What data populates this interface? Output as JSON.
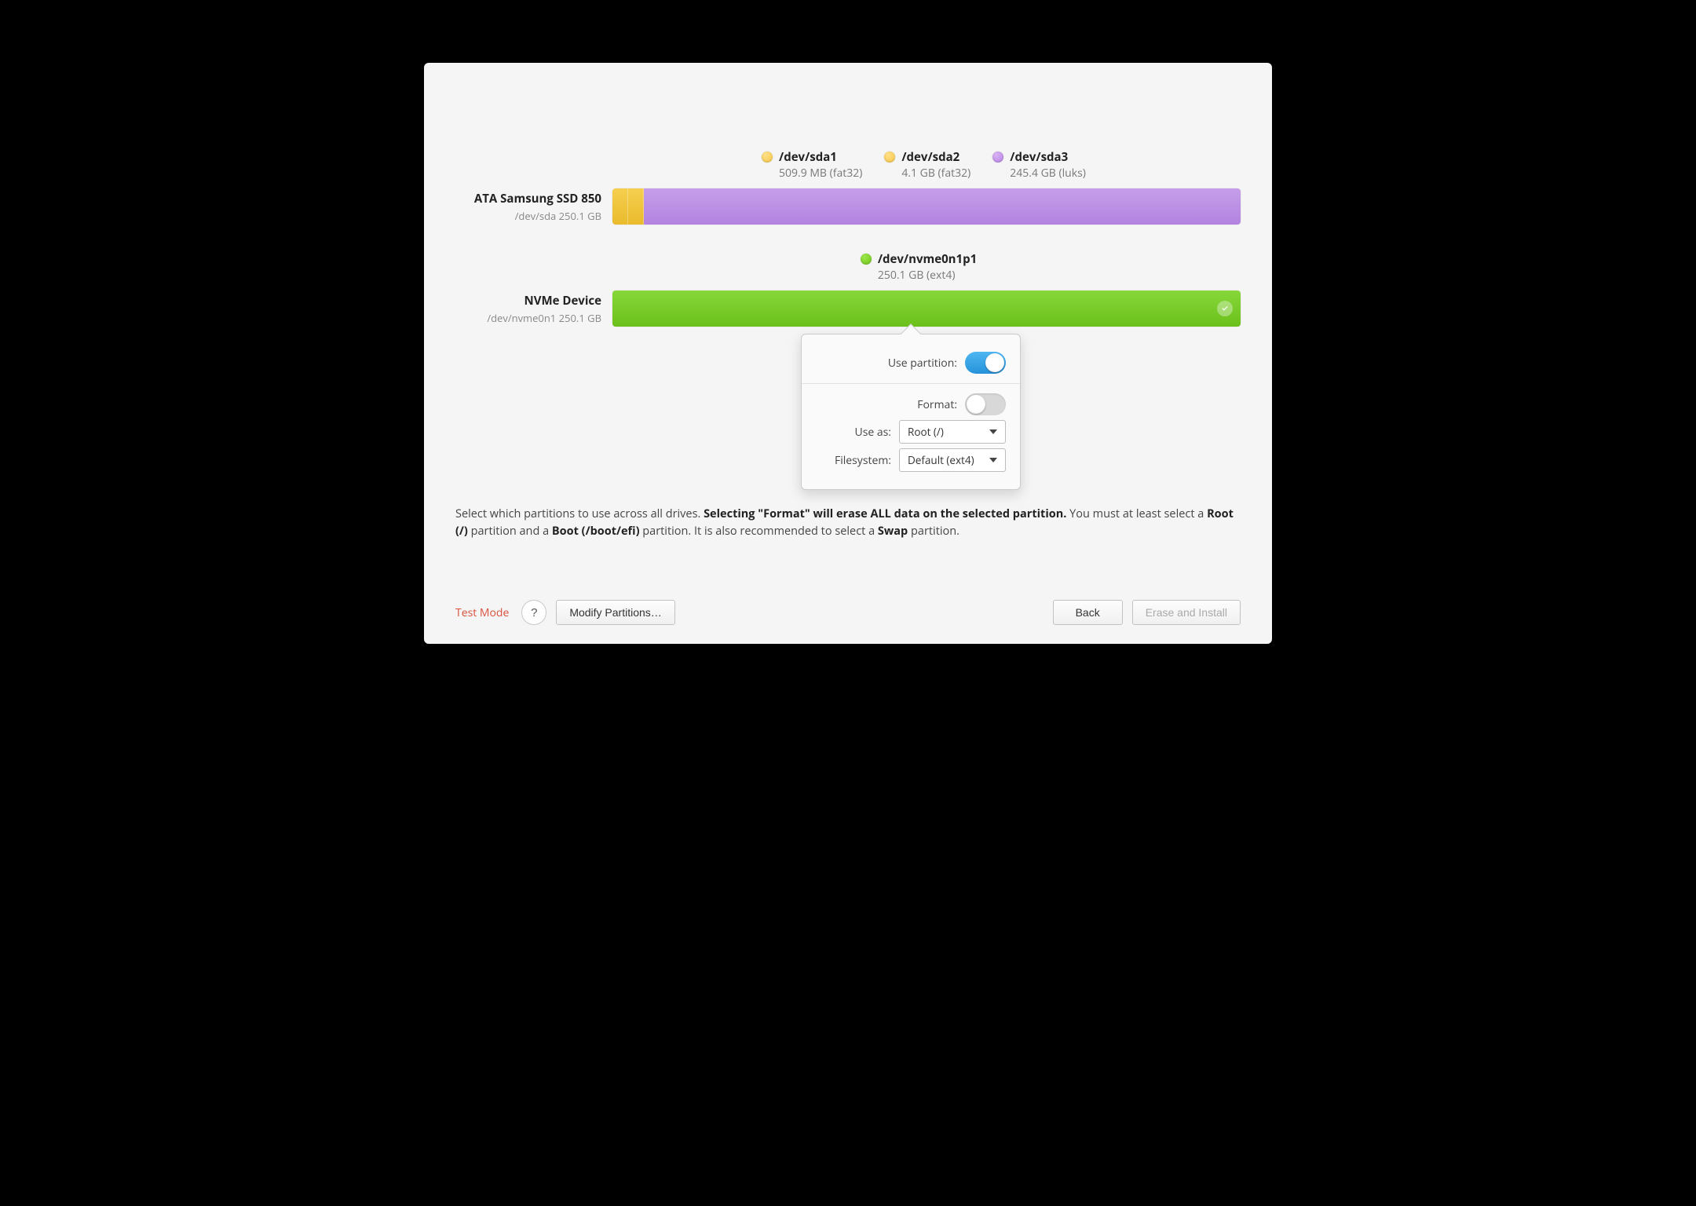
{
  "legendA": [
    {
      "name": "/dev/sda1",
      "sub": "509.9 MB (fat32)",
      "color": "yellow"
    },
    {
      "name": "/dev/sda2",
      "sub": "4.1 GB (fat32)",
      "color": "yellow"
    },
    {
      "name": "/dev/sda3",
      "sub": "245.4 GB (luks)",
      "color": "purple"
    }
  ],
  "diskA": {
    "name": "ATA Samsung SSD 850",
    "sub": "/dev/sda 250.1 GB",
    "segments": [
      {
        "color": "yellow",
        "pct": 2.5
      },
      {
        "color": "yellow",
        "pct": 2.5
      },
      {
        "color": "purple",
        "pct": 95
      }
    ]
  },
  "legendB": [
    {
      "name": "/dev/nvme0n1p1",
      "sub": "250.1 GB (ext4)",
      "color": "green"
    }
  ],
  "diskB": {
    "name": "NVMe Device",
    "sub": "/dev/nvme0n1 250.1 GB",
    "segments": [
      {
        "color": "green",
        "pct": 100
      }
    ]
  },
  "popover": {
    "use_partition_label": "Use partition:",
    "use_partition_on": true,
    "format_label": "Format:",
    "format_on": false,
    "use_as_label": "Use as:",
    "use_as_value": "Root (/)",
    "filesystem_label": "Filesystem:",
    "filesystem_value": "Default (ext4)"
  },
  "help": {
    "t1": "Select which partitions to use across all drives. ",
    "t2": "Selecting \"Format\" will erase ALL data on the selected partition.",
    "t3": " You must at least select a ",
    "t4": "Root (/)",
    "t5": " partition and a ",
    "t6": "Boot (/boot/efi)",
    "t7": " partition. It is also recommended to select a ",
    "t8": "Swap",
    "t9": " partition."
  },
  "footer": {
    "test_mode": "Test Mode",
    "help_glyph": "?",
    "modify": "Modify Partitions…",
    "back": "Back",
    "erase_install": "Erase and Install"
  }
}
